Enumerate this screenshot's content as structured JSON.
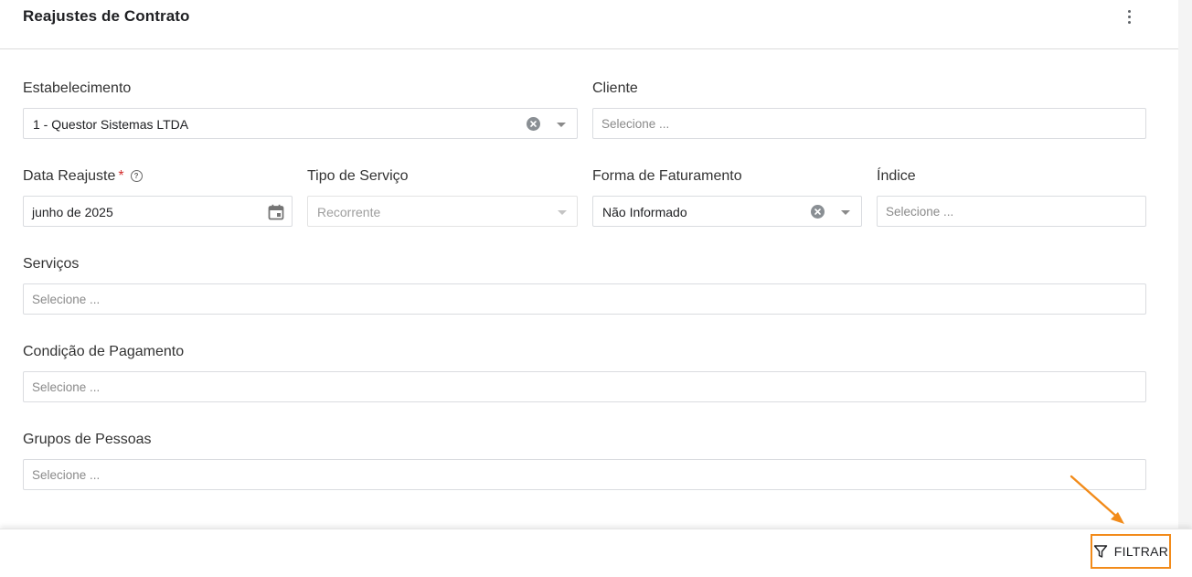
{
  "header": {
    "title": "Reajustes de Contrato",
    "more_icon": "more-vert-icon"
  },
  "form": {
    "estabelecimento": {
      "label": "Estabelecimento",
      "value": "1 - Questor Sistemas LTDA"
    },
    "cliente": {
      "label": "Cliente",
      "placeholder": "Selecione ..."
    },
    "data_reajuste": {
      "label": "Data Reajuste",
      "required_mark": "*",
      "help_icon": "?",
      "value": "junho de 2025"
    },
    "tipo_servico": {
      "label": "Tipo de Serviço",
      "value": "Recorrente"
    },
    "forma_faturamento": {
      "label": "Forma de Faturamento",
      "value": "Não Informado"
    },
    "indice": {
      "label": "Índice",
      "placeholder": "Selecione ..."
    },
    "servicos": {
      "label": "Serviços",
      "placeholder": "Selecione ..."
    },
    "condicao_pagamento": {
      "label": "Condição de Pagamento",
      "placeholder": "Selecione ..."
    },
    "grupos_pessoas": {
      "label": "Grupos de Pessoas",
      "placeholder": "Selecione ..."
    }
  },
  "footer": {
    "filter_label": "FILTRAR",
    "filter_icon": "filter-icon",
    "highlight_color": "#f28b1a"
  }
}
